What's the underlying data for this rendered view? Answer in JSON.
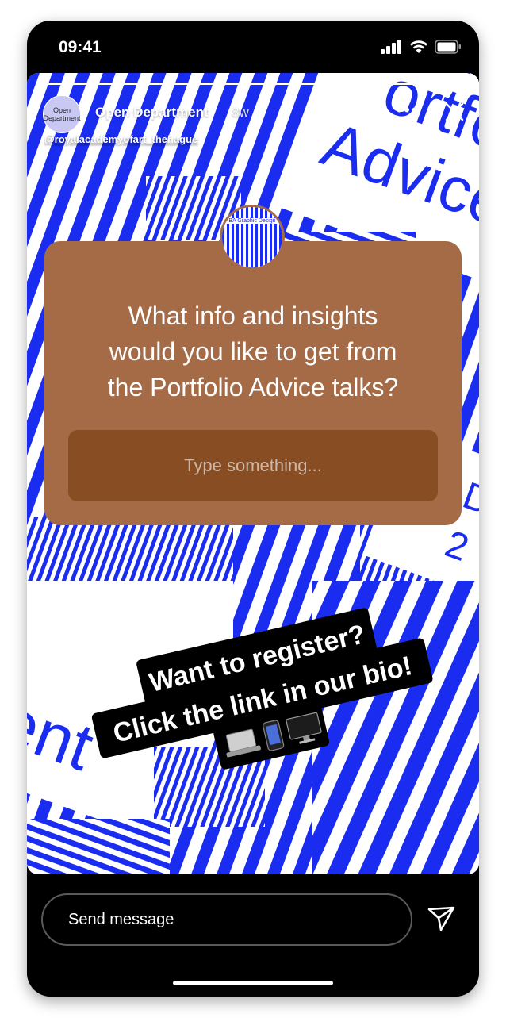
{
  "status_bar": {
    "time": "09:41"
  },
  "story": {
    "progress": 1.0,
    "profile": {
      "avatar_text": [
        "Open",
        "Department"
      ],
      "name": "Open Department",
      "time_ago": "8w",
      "handle": "@royalacademyofart_thehague"
    },
    "more_label": "•••",
    "background": {
      "poster_words": [
        "ortfo",
        "Advice",
        "ent"
      ],
      "poster_digits": [
        "D",
        "2"
      ],
      "colors": {
        "stripe": "#1a2cf0",
        "paper": "#ffffff"
      }
    },
    "question_card": {
      "avatar_label": "BA Graphic Design",
      "question_lines": [
        "What info and insights",
        "would you like to get from",
        "the Portfolio Advice talks?"
      ],
      "input_placeholder": "Type something...",
      "card_color": "#a56b46",
      "input_color": "#884d22"
    },
    "sticker": {
      "lines": [
        "Want to register?",
        "Click the link in our bio!"
      ],
      "emoji_icons": [
        "laptop-icon",
        "phone-icon",
        "desktop-icon"
      ]
    }
  },
  "bottom_bar": {
    "message_placeholder": "Send message"
  }
}
